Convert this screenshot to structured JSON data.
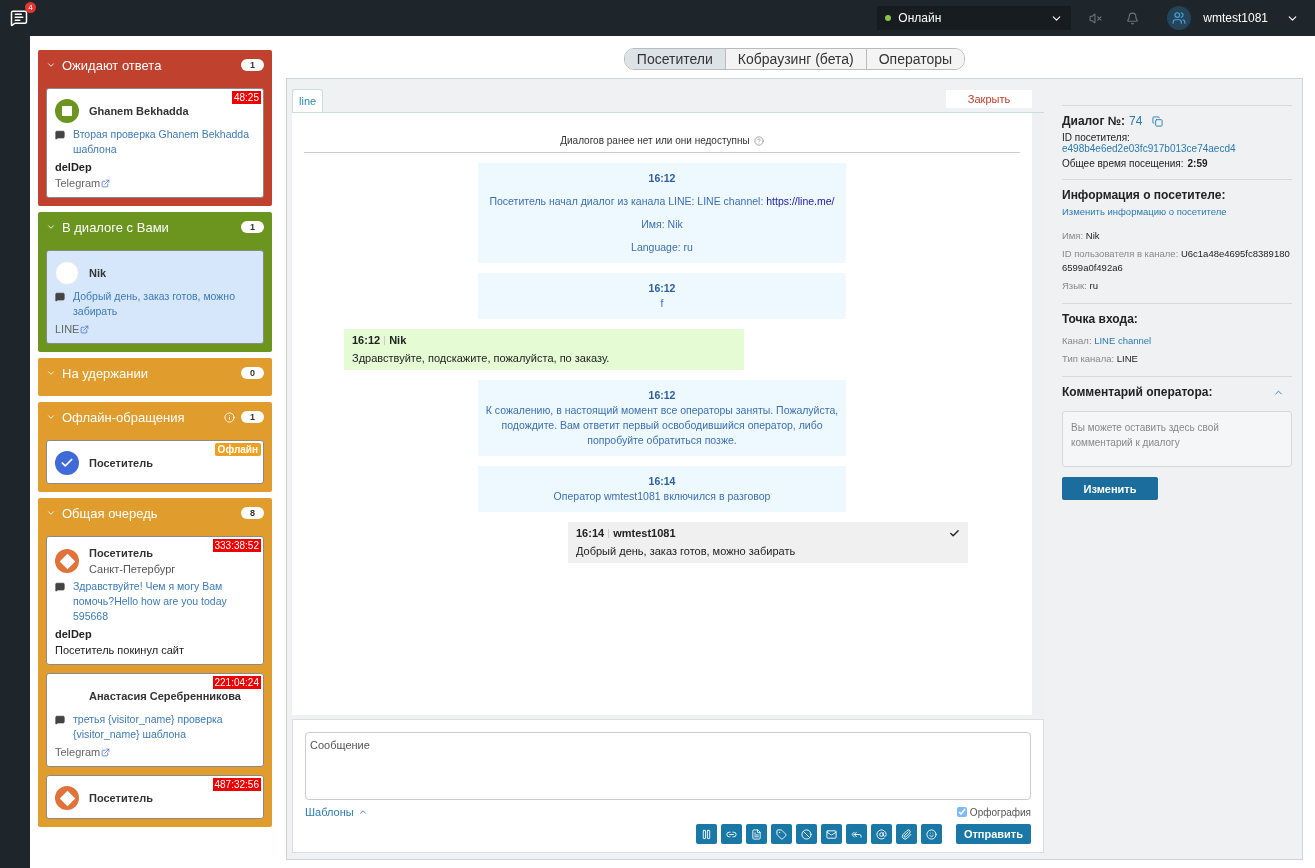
{
  "topbar": {
    "notifications": "4",
    "status": {
      "label": "Онлайн",
      "online": true
    },
    "user": "wmtest1081"
  },
  "queue": [
    {
      "title": "Ожидают ответа",
      "count": "1",
      "color": "#c0412e",
      "expanded": true,
      "info": false,
      "cards": [
        {
          "kind": "square",
          "timer": "48:25",
          "name": "Ghanem Bekhadda",
          "message": "Вторая проверка Ghanem Bekhadda шаблона",
          "department": "delDep",
          "channel": "Telegram",
          "selected": false
        }
      ]
    },
    {
      "title": "В диалоге с Вами",
      "count": "1",
      "color": "#6b951f",
      "expanded": true,
      "info": false,
      "cards": [
        {
          "kind": "blank",
          "name": "Nik",
          "message": "Добрый день, заказ готов, можно забирать",
          "channel": "LINE",
          "selected": true
        }
      ]
    },
    {
      "title": "На удержании",
      "count": "0",
      "color": "#e09c2c",
      "expanded": true,
      "info": false
    },
    {
      "title": "Офлайн-обращения",
      "count": "1",
      "color": "#e09c2c",
      "expanded": true,
      "info": true,
      "cards": [
        {
          "kind": "check",
          "badge": "Офлайн",
          "name": "Посетитель",
          "selected": false
        }
      ]
    },
    {
      "title": "Общая очередь",
      "count": "8",
      "color": "#e09c2c",
      "expanded": true,
      "info": false,
      "cards": [
        {
          "kind": "diamond",
          "timer": "333:38:52",
          "name": "Посетитель",
          "city": "Санкт-Петербург",
          "message": "Здравствуйте! Чем я могу Вам помочь?Hello how are you today 595668",
          "department": "delDep",
          "note": "Посетитель покинул сайт",
          "selected": false
        },
        {
          "kind": "plain",
          "timer": "221:04:24",
          "name": "Анастасия Серебренникова",
          "message": "третья {visitor_name} проверка {visitor_name} шаблона",
          "channel": "Telegram",
          "selected": false
        },
        {
          "kind": "diamond",
          "timer": "487:32:56",
          "name": "Посетитель",
          "selected": false
        }
      ]
    }
  ],
  "tabs": [
    {
      "label": "Посетители",
      "selected": true
    },
    {
      "label": "Кобраузинг (бета)",
      "selected": false
    },
    {
      "label": "Операторы",
      "selected": false
    }
  ],
  "dialog_tabs": [
    {
      "label": "line",
      "selected": true
    }
  ],
  "close_button": "Закрыть",
  "history_note": "Диалогов ранее нет или они недоступны",
  "messages": [
    {
      "kind": "system",
      "time": "16:12",
      "lines": [
        {
          "text": "Посетитель начал диалог из канала LINE: LINE channel:",
          "link": "https://line.me/"
        },
        {
          "text": "Имя: Nik"
        },
        {
          "text": "Language: ru"
        }
      ]
    },
    {
      "kind": "system",
      "time": "16:12",
      "lines": [
        {
          "text": "f"
        }
      ]
    },
    {
      "kind": "visitor",
      "time": "16:12",
      "author": "Nik",
      "text": "Здравствуйте, подскажите, пожалуйста, по заказу."
    },
    {
      "kind": "system",
      "time": "16:12",
      "lines": [
        {
          "text": "К сожалению, в настоящий момент все операторы заняты. Пожалуйста, подождите. Вам ответит первый освободившийся оператор, либо попробуйте обратиться позже."
        }
      ]
    },
    {
      "kind": "system",
      "time": "16:14",
      "lines": [
        {
          "text": "Оператор wmtest1081 включился в разговор"
        }
      ]
    },
    {
      "kind": "operator",
      "time": "16:14",
      "author": "wmtest1081",
      "text": "Добрый день, заказ готов, можно забирать",
      "delivered": true
    }
  ],
  "composer": {
    "placeholder": "Сообщение",
    "templates": "Шаблоны",
    "spellcheck": {
      "label": "Орфография",
      "checked": true
    },
    "send": "Отправить"
  },
  "info": {
    "dialog_label": "Диалог №:",
    "dialog_number": "74",
    "visitor_id_label": "ID посетителя:",
    "visitor_id": "e498b4e6ed2e03fc917b013ce74aecd4",
    "total_time_label": "Общее время посещения:",
    "total_time": "2:59",
    "visitor_title": "Информация о посетителе:",
    "edit_link": "Изменить информацию о посетителе",
    "visitor_fields": [
      {
        "label": "Имя:",
        "value": "Nik"
      },
      {
        "label": "ID пользователя в канале:",
        "value": "U6c1a48e4695fc83891806599a0f492a6"
      },
      {
        "label": "Язык:",
        "value": "ru"
      }
    ],
    "entry_title": "Точка входа:",
    "entry_fields": [
      {
        "label": "Канал:",
        "value": "LINE channel",
        "link": true
      },
      {
        "label": "Тип канала:",
        "value": "LINE",
        "link": false
      }
    ],
    "comment_title": "Комментарий оператора:",
    "comment_expanded": true,
    "comment_placeholder": "Вы можете оставить здесь свой комментарий к диалогу",
    "comment_button": "Изменить"
  }
}
